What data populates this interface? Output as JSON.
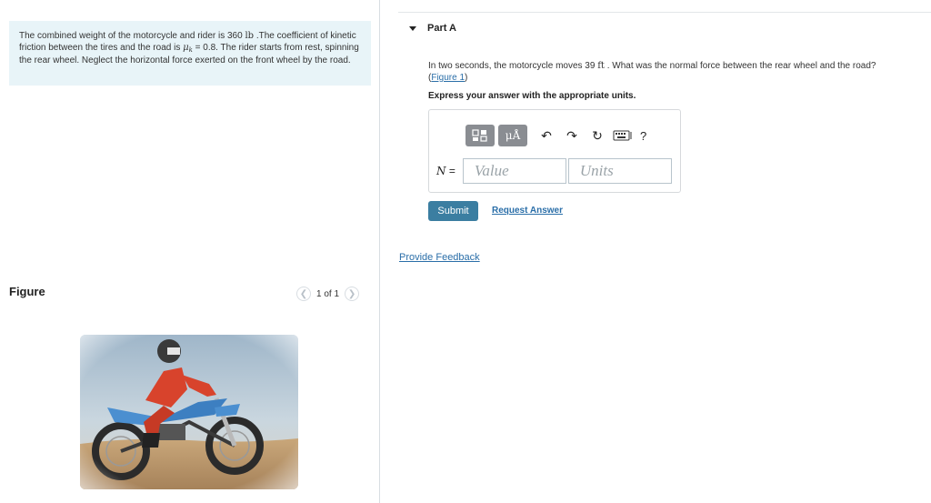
{
  "problem": {
    "text_1": "The combined weight of the motorcycle and rider is 360 ",
    "unit_lb": "lb",
    "text_2": " .The coefficient of kinetic friction between the tires and the road is ",
    "mu": "μ",
    "mu_sub": "k",
    "text_3": " = 0.8. The rider starts from rest, spinning the rear wheel. Neglect the horizontal force exerted on the front wheel by the road."
  },
  "figure": {
    "title": "Figure",
    "pager_text": "1 of 1",
    "prev_icon": "chevron-left-icon",
    "next_icon": "chevron-right-icon"
  },
  "part": {
    "label": "Part A"
  },
  "question": {
    "text_1": "In two seconds, the motorcycle moves 39 ",
    "unit_ft": "ft",
    "text_2": " . What was the normal force between the rear wheel and the road?",
    "figure_link": "Figure 1",
    "paren_open": "(",
    "paren_close": ")"
  },
  "instruction": "Express your answer with the appropriate units.",
  "toolbar": {
    "templates_icon": "templates-icon",
    "units_label": "μÅ",
    "undo_icon": "undo-icon",
    "redo_icon": "redo-icon",
    "reset_icon": "reset-icon",
    "keyboard_icon": "keyboard-icon",
    "help_label": "?"
  },
  "answer": {
    "variable": "N",
    "equals": " =",
    "value_placeholder": "Value",
    "units_placeholder": "Units"
  },
  "buttons": {
    "submit": "Submit",
    "request_answer": "Request Answer",
    "provide_feedback": "Provide Feedback"
  },
  "colors": {
    "problem_bg": "#e8f4f8",
    "submit_bg": "#3b7ea1",
    "link": "#2a6ea8",
    "toolbar_btn": "#8a8d92"
  }
}
